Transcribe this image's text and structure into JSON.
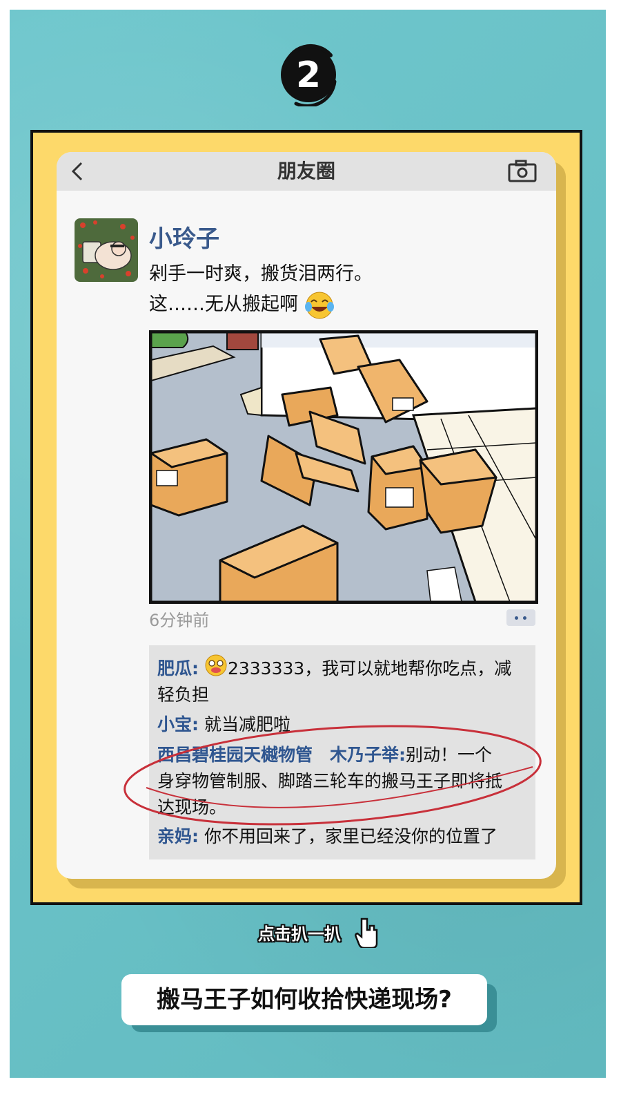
{
  "badge": {
    "number": "2"
  },
  "moments": {
    "header_title": "朋友圈",
    "post": {
      "username": "小玲子",
      "text_line1": "剁手一时爽，搬货泪两行。",
      "text_line2": "这……无从搬起啊",
      "emoji": "laughing-tears-emoji",
      "timestamp": "6分钟前"
    },
    "comments": [
      {
        "name": "肥瓜:",
        "text": "2333333，我可以就地帮你吃点，减",
        "text2": "轻负担",
        "emoji": "drooling-emoji"
      },
      {
        "name": "小宝:",
        "text": "就当减肥啦"
      },
      {
        "name": "西昌碧桂园天樾物管　木乃子举:",
        "text": "别动！一个",
        "text2": "身穿物管制服、脚踏三轮车的搬马王子即将抵",
        "text3": "达现场。"
      },
      {
        "name": "亲妈:",
        "text": "你不用回来了，家里已经没你的位置了"
      }
    ]
  },
  "tap_hint": "点击扒一扒",
  "cta_button": "搬马王子如何收拾快递现场?",
  "colors": {
    "teal": "#67c4ca",
    "yellow": "#fdd96a",
    "name_blue": "#2f5690",
    "highlight_red": "#c8303a"
  }
}
